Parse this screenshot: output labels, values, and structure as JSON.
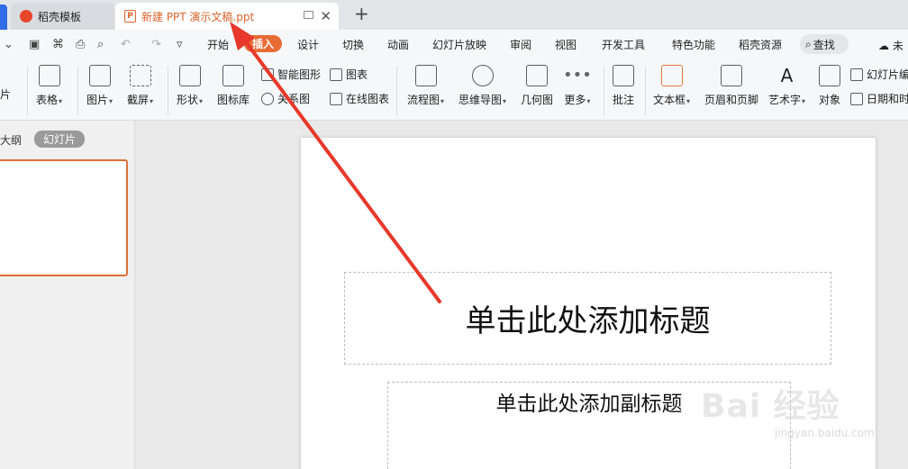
{
  "tabs": [
    {
      "label": "稻壳模板"
    },
    {
      "label": "新建 PPT 演示文稿.ppt"
    }
  ],
  "menu": {
    "items": [
      "开始",
      "插入",
      "设计",
      "切换",
      "动画",
      "幻灯片放映",
      "审阅",
      "视图",
      "开发工具",
      "特色功能",
      "稻壳资源"
    ],
    "active": "插入",
    "search_label": "查找",
    "cloud_label": "未"
  },
  "ribbon": {
    "partial_left": "片",
    "table": "表格",
    "picture": "图片",
    "screenshot": "截屏",
    "shape": "形状",
    "icon_library": "图标库",
    "smart_graphic": "智能图形",
    "chart": "图表",
    "relation_graph": "关系图",
    "online_chart": "在线图表",
    "flowchart": "流程图",
    "mindmap": "思维导图",
    "geometry": "几何图",
    "more": "更多",
    "comment": "批注",
    "textbox": "文本框",
    "header_footer": "页眉和页脚",
    "wordart": "艺术字",
    "object": "对象",
    "slide_number": "幻灯片编",
    "date_time": "日期和时"
  },
  "left_panel": {
    "outline_tab": "大纲",
    "slides_tab": "幻灯片"
  },
  "slide": {
    "title_placeholder": "单击此处添加标题",
    "subtitle_placeholder": "单击此处添加副标题"
  },
  "watermark": {
    "main": "Bai 经验",
    "sub": "jingyan.baidu.com"
  },
  "colors": {
    "accent": "#e86b34",
    "tab_active_text": "#d9632b",
    "arrow": "#e8382b"
  }
}
